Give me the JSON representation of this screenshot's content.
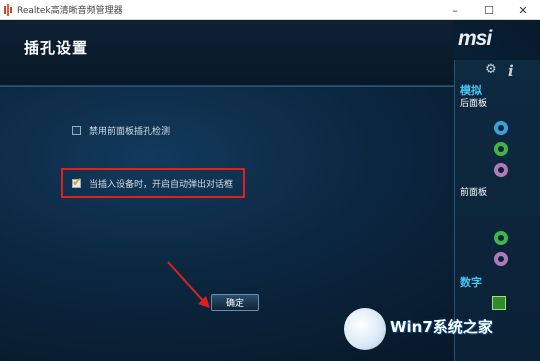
{
  "window": {
    "title": "Realtek高清晰音频管理器",
    "minimize": "–",
    "maximize": "☐",
    "close": "✕"
  },
  "header": {
    "title": "插孔设置",
    "brand": "msi"
  },
  "options": [
    {
      "label": "禁用前面板插孔检测",
      "checked": false
    },
    {
      "label": "当插入设备时，开启自动弹出对话框",
      "checked": true
    }
  ],
  "ok_button": {
    "label": "确定"
  },
  "sidebar": {
    "analog_header": "模拟",
    "back_panel": "后面板",
    "front_panel": "前面板",
    "digital_header": "数字",
    "icons": [
      "gear-icon",
      "info-icon"
    ]
  },
  "colors": {
    "accent": "#46c4f2",
    "highlight": "#e02020",
    "jack_blue": "#3aa0d8",
    "jack_green": "#3fb54a",
    "jack_pink": "#b07ab8"
  },
  "watermark": {
    "text": "Win7系统之家"
  }
}
